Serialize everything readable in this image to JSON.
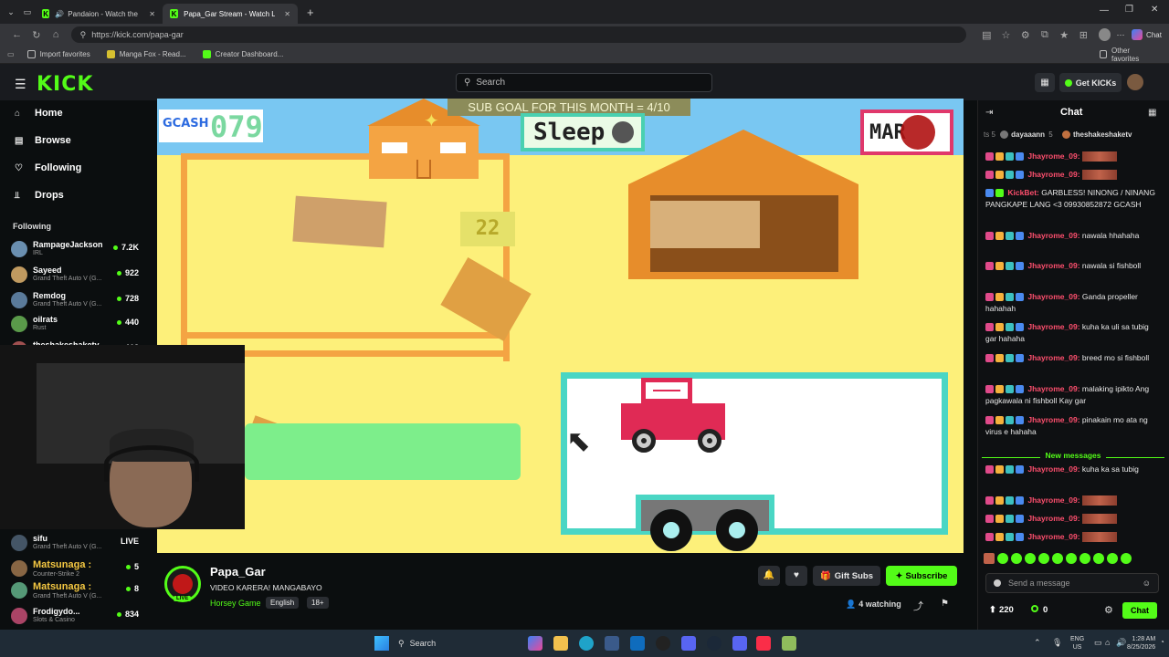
{
  "browser": {
    "tabs": [
      {
        "title": "Pandaion - Watch the VOD o"
      },
      {
        "title": "Papa_Gar Stream - Watch Live on"
      }
    ],
    "url": "https://kick.com/papa-gar",
    "profile_label": "Chat",
    "bookmarks": [
      "Import favorites",
      "Manga Fox - Read...",
      "Creator Dashboard..."
    ],
    "other_favorites": "Other favorites"
  },
  "kick": {
    "logo": "KICK",
    "search_placeholder": "Search",
    "get_kicks": "Get KICKs"
  },
  "sidebar": {
    "nav": [
      "Home",
      "Browse",
      "Following",
      "Drops"
    ],
    "following_header": "Following",
    "channels": [
      {
        "name": "RampageJackson",
        "game": "IRL",
        "viewers": "7.2K",
        "color": "#6a8fb0"
      },
      {
        "name": "Sayeed",
        "game": "Grand Theft Auto V (G...",
        "viewers": "922",
        "color": "#c09a60"
      },
      {
        "name": "Remdog",
        "game": "Grand Theft Auto V (G...",
        "viewers": "728",
        "color": "#5a7a9a"
      },
      {
        "name": "oilrats",
        "game": "Rust",
        "viewers": "440",
        "color": "#5a9a4a"
      },
      {
        "name": "theshakeshakety",
        "game": "",
        "viewers": "113",
        "color": "#a05050"
      }
    ],
    "overlay_rows": [
      {
        "name": "sifu",
        "game": "Grand Theft Auto V (G...",
        "viewers": "LIVE"
      },
      {
        "name": "Matsunaga :",
        "game": "Counter-Strike 2",
        "viewers": "5"
      },
      {
        "name": "Matsunaga :",
        "game": "Grand Theft Auto V (G...",
        "viewers": "8"
      },
      {
        "name": "Frodigydo...",
        "game": "Slots & Casino",
        "viewers": "834"
      }
    ]
  },
  "game": {
    "sub_goal": "SUB GOAL FOR THIS MONTH = 4/10",
    "gcash_label": "GCASH",
    "gcash_number": "079",
    "sleep_label": "Sleep",
    "market_label": "MAR",
    "counter": "22"
  },
  "stream": {
    "channel": "Papa_Gar",
    "title": "VIDEO KARERA! MANGABAYO",
    "category": "Horsey Game",
    "tags": [
      "English",
      "18+"
    ],
    "live_badge": "LIVE",
    "gift_subs": "Gift Subs",
    "subscribe": "Subscribe",
    "watching": "4 watching"
  },
  "chat": {
    "title": "Chat",
    "top_gifters": [
      {
        "name": "dayaaann",
        "count": "5"
      },
      {
        "name": "theshakeshaketv",
        "count": ""
      }
    ],
    "messages": [
      {
        "user": "Jhayrome_09:",
        "text": "",
        "redacted": true
      },
      {
        "user": "Jhayrome_09:",
        "text": "",
        "redacted": true
      },
      {
        "user": "KickBet:",
        "text": "GARBLESS! NINONG / NINANG PANGKAPE LANG <3 09930852872 GCASH",
        "redacted": false
      },
      {
        "user": "Jhayrome_09:",
        "text": "nawala hhahaha",
        "redacted": false
      },
      {
        "user": "Jhayrome_09:",
        "text": "nawala si fishboll",
        "redacted": false
      },
      {
        "user": "Jhayrome_09:",
        "text": "Ganda propeller hahahah",
        "redacted": false
      },
      {
        "user": "Jhayrome_09:",
        "text": "kuha ka uli sa tubig gar hahaha",
        "redacted": false
      },
      {
        "user": "Jhayrome_09:",
        "text": "breed mo si fishboll",
        "redacted": false
      },
      {
        "user": "Jhayrome_09:",
        "text": "malaking ipikto Ang pagkawala ni fishboll Kay gar",
        "redacted": false
      },
      {
        "user": "Jhayrome_09:",
        "text": "pinakain mo ata ng virus e hahaha",
        "redacted": false
      }
    ],
    "new_messages_label": "New messages",
    "after_messages": [
      {
        "user": "Jhayrome_09:",
        "text": "kuha ka sa tubig",
        "redacted": false
      },
      {
        "user": "Jhayrome_09:",
        "text": "",
        "redacted": true
      },
      {
        "user": "Jhayrome_09:",
        "text": "",
        "redacted": true
      },
      {
        "user": "Jhayrome_09:",
        "text": "",
        "redacted": true
      }
    ],
    "input_placeholder": "Send a message",
    "points": "220",
    "kicks": "0",
    "send_label": "Chat"
  },
  "taskbar": {
    "search": "Search",
    "lang": "ENG",
    "region": "US",
    "time": "1:28 AM",
    "date": "8/25/2026"
  },
  "colors": {
    "kick_green": "#53fc18",
    "game_bg": "#fdf07a",
    "chat_user": "#ff4f6e"
  }
}
